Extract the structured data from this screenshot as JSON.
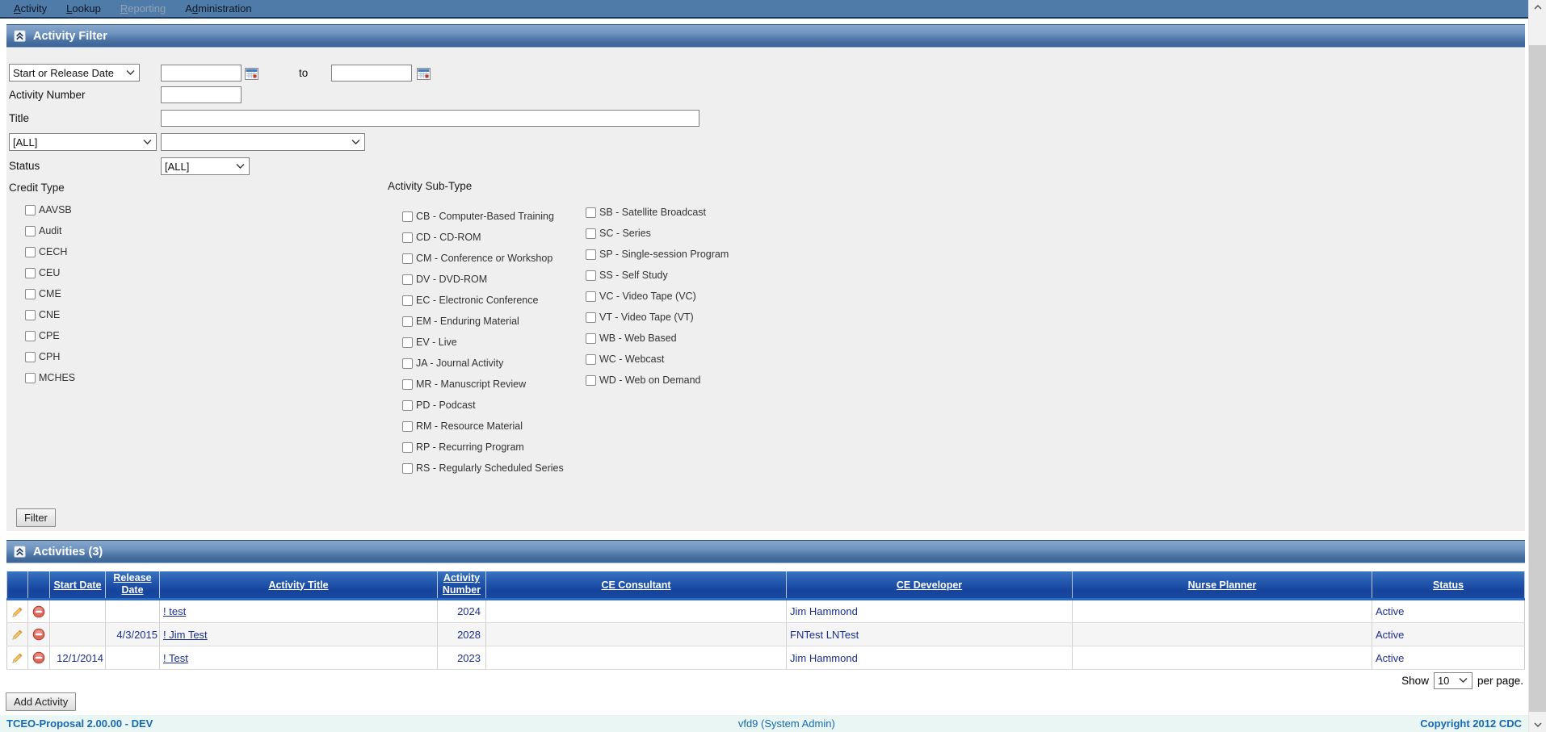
{
  "nav": {
    "items": [
      {
        "label": "Activity",
        "access_key": "A",
        "enabled": true
      },
      {
        "label": "Lookup",
        "access_key": "L",
        "enabled": true
      },
      {
        "label": "Reporting",
        "access_key": "R",
        "enabled": false
      },
      {
        "label": "Administration",
        "access_key": "d",
        "enabled": true
      }
    ]
  },
  "filter": {
    "header_title": "Activity Filter",
    "date_type_value": "Start or Release Date",
    "date_from_value": "",
    "date_to_value": "",
    "to_label": "to",
    "activity_number_label": "Activity Number",
    "activity_number_value": "",
    "title_label": "Title",
    "title_value": "",
    "type_value": "[ALL]",
    "subtype_value": "",
    "status_label": "Status",
    "status_value": "[ALL]",
    "credit_type_heading": "Credit Type",
    "credit_types": [
      "AAVSB",
      "Audit",
      "CECH",
      "CEU",
      "CME",
      "CNE",
      "CPE",
      "CPH",
      "MCHES"
    ],
    "subtype_heading": "Activity Sub-Type",
    "subtypes_left": [
      "CB - Computer-Based Training",
      "CD - CD-ROM",
      "CM - Conference or Workshop",
      "DV - DVD-ROM",
      "EC - Electronic Conference",
      "EM - Enduring Material",
      "EV - Live",
      "JA - Journal Activity",
      "MR - Manuscript Review",
      "PD - Podcast",
      "RM - Resource Material",
      "RP - Recurring Program",
      "RS - Regularly Scheduled Series"
    ],
    "subtypes_right": [
      "SB - Satellite Broadcast",
      "SC - Series",
      "SP - Single-session Program",
      "SS - Self Study",
      "VC - Video Tape (VC)",
      "VT - Video Tape (VT)",
      "WB - Web Based",
      "WC - Webcast",
      "WD - Web on Demand"
    ],
    "filter_button_label": "Filter"
  },
  "activities": {
    "header_title": "Activities (3)",
    "columns": [
      "",
      "",
      "Start Date",
      "Release Date",
      "Activity Title",
      "Activity Number",
      "CE Consultant",
      "CE Developer",
      "Nurse Planner",
      "Status"
    ],
    "rows": [
      {
        "start_date": "",
        "release_date": "",
        "title": "! test",
        "number": "2024",
        "ce_consultant": "",
        "ce_developer": "Jim Hammond",
        "nurse_planner": "",
        "status": "Active"
      },
      {
        "start_date": "",
        "release_date": "4/3/2015",
        "title": "! Jim Test",
        "number": "2028",
        "ce_consultant": "",
        "ce_developer": "FNTest LNTest",
        "nurse_planner": "",
        "status": "Active"
      },
      {
        "start_date": "12/1/2014",
        "release_date": "",
        "title": "! Test",
        "number": "2023",
        "ce_consultant": "",
        "ce_developer": "Jim Hammond",
        "nurse_planner": "",
        "status": "Active"
      }
    ],
    "show_label": "Show",
    "per_page_value": "10",
    "per_page_suffix": "per page.",
    "add_button_label": "Add Activity"
  },
  "footer": {
    "left": "TCEO-Proposal 2.00.00 - DEV",
    "center": "vfd9 (System Admin)",
    "right": "Copyright 2012 CDC"
  },
  "colors": {
    "nav_bg": "#4f7ba9",
    "header_bar_top": "#87a7cb",
    "header_bar_bottom": "#3d6399",
    "table_header_top": "#3a74c2",
    "table_header_bottom": "#16439c",
    "panel_bg": "#efefef",
    "link_text": "#1b2f8f",
    "footer_bg": "#eaf6f3",
    "footer_text": "#1569b3",
    "disabled_nav": "#93a2b3"
  }
}
